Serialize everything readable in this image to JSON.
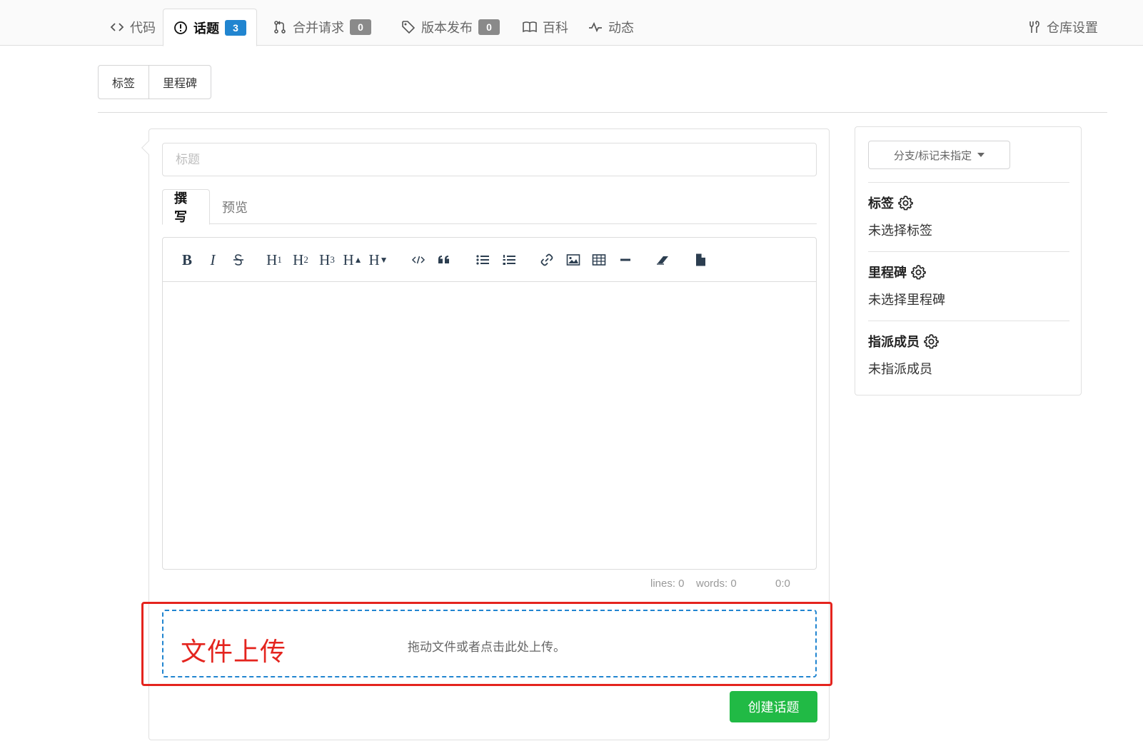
{
  "nav": {
    "code": "代码",
    "issues": "话题",
    "issues_count": "3",
    "pulls": "合并请求",
    "pulls_count": "0",
    "releases": "版本发布",
    "releases_count": "0",
    "wiki": "百科",
    "activity": "动态",
    "settings": "仓库设置"
  },
  "subnav": {
    "labels": "标签",
    "milestones": "里程碑"
  },
  "form": {
    "title_placeholder": "标题",
    "tab_write": "撰写",
    "tab_preview": "预览",
    "status_lines": "lines: 0",
    "status_words": "words: 0",
    "status_cursor": "0:0",
    "upload_label": "文件上传",
    "upload_hint": "拖动文件或者点击此处上传。",
    "submit": "创建话题"
  },
  "toolbar": {
    "bold": "B",
    "italic": "I",
    "heading_letter": "H",
    "h1_sub": "1",
    "h2_sub": "2",
    "h3_sub": "3"
  },
  "sidebar": {
    "branch_button": "分支/标记未指定",
    "labels_title": "标签",
    "labels_value": "未选择标签",
    "milestone_title": "里程碑",
    "milestone_value": "未选择里程碑",
    "assignees_title": "指派成员",
    "assignees_value": "未指派成员"
  },
  "colors": {
    "accent_blue": "#2185d0",
    "submit_green": "#21ba45",
    "highlight_red": "#e4241e",
    "badge_grey": "#8a8a8a"
  }
}
